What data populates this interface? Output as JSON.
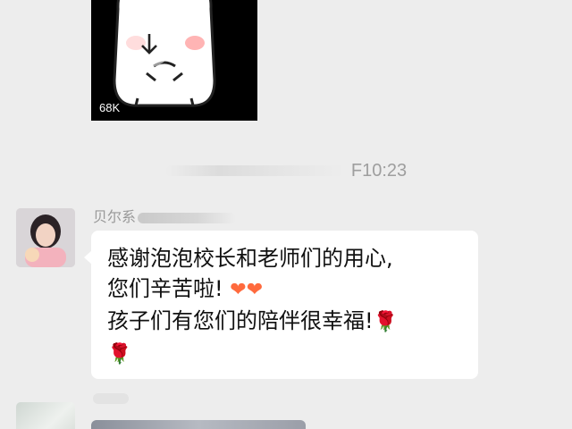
{
  "sticker": {
    "size_label": "68K",
    "download_icon": "download-arrow-icon"
  },
  "timestamp": {
    "time": "F10:23"
  },
  "message1": {
    "sender": "贝尔系",
    "lines": [
      "感谢泡泡校长和老师们的用心,",
      "您们辛苦啦!",
      "孩子们有您们的陪伴很幸福!",
      ""
    ],
    "emoji": {
      "heart": "❤",
      "rose": "🌹"
    }
  },
  "colors": {
    "background": "#ededed",
    "bubble": "#ffffff",
    "timestamp_text": "#9e9e9e",
    "heart": "#ff6a3d",
    "rose": "#d8342b"
  }
}
